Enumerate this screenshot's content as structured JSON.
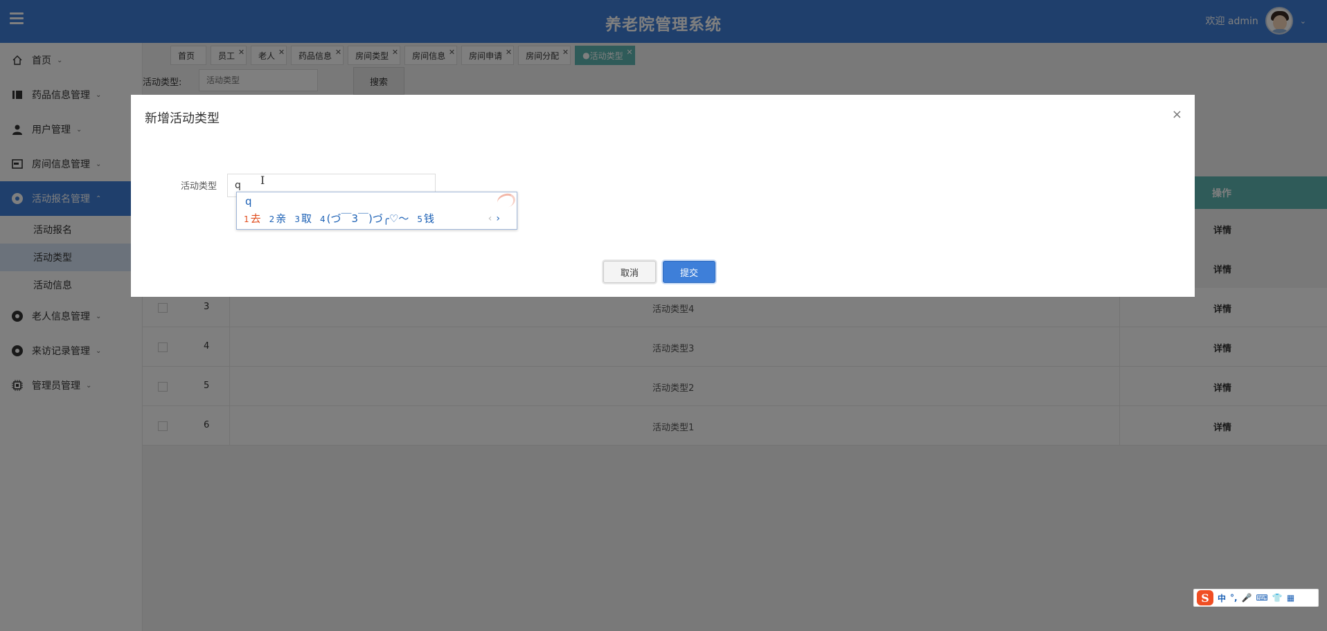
{
  "header": {
    "title": "养老院管理系统",
    "welcome": "欢迎 admin",
    "menu_icon": "hamburger-icon",
    "avatar_icon": "avatar-icon"
  },
  "sidebar": {
    "items": [
      {
        "label": "首页",
        "icon": "home-icon"
      },
      {
        "label": "药品信息管理",
        "icon": "medicine-icon"
      },
      {
        "label": "用户管理",
        "icon": "user-icon"
      },
      {
        "label": "房间信息管理",
        "icon": "room-icon"
      },
      {
        "label": "活动报名管理",
        "icon": "activity-icon"
      },
      {
        "label": "老人信息管理",
        "icon": "elder-icon"
      },
      {
        "label": "来访记录管理",
        "icon": "visit-icon"
      },
      {
        "label": "管理员管理",
        "icon": "admin-icon"
      }
    ],
    "sub_items": [
      "活动报名",
      "活动类型",
      "活动信息"
    ]
  },
  "tabs": [
    "首页",
    "员工",
    "老人",
    "药品信息",
    "房间类型",
    "房间信息",
    "房间申请",
    "房间分配",
    "活动类型"
  ],
  "search": {
    "label": "活动类型:",
    "placeholder": "活动类型",
    "button": "搜索"
  },
  "table": {
    "operation_header": "操作",
    "rows": [
      {
        "index": "3",
        "name": "活动类型4",
        "action": "详情"
      },
      {
        "index": "4",
        "name": "活动类型3",
        "action": "详情"
      },
      {
        "index": "5",
        "name": "活动类型2",
        "action": "详情"
      },
      {
        "index": "6",
        "name": "活动类型1",
        "action": "详情"
      }
    ],
    "hidden_row_actions": [
      "详情",
      "详情"
    ]
  },
  "dialog": {
    "title": "新增活动类型",
    "close": "×",
    "field_label": "活动类型",
    "field_value": "q",
    "cancel": "取消",
    "submit": "提交"
  },
  "ime": {
    "typed": "q",
    "candidates": [
      {
        "num": "1",
        "text": "去"
      },
      {
        "num": "2",
        "text": "亲"
      },
      {
        "num": "3",
        "text": "取"
      },
      {
        "num": "4",
        "text": "(づ￣3￣)づ╭♡～"
      },
      {
        "num": "5",
        "text": "钱"
      }
    ],
    "prev": "‹",
    "next": "›",
    "toolbar": {
      "logo": "S",
      "mode": "中",
      "punct": "°,",
      "mic": "🎤",
      "keyboard": "⌨",
      "skin": "👕",
      "apps": "▦"
    }
  },
  "colors": {
    "primary": "#3e7fd9",
    "teal": "#5fb7b3",
    "ime_highlight": "#e04a1a"
  }
}
